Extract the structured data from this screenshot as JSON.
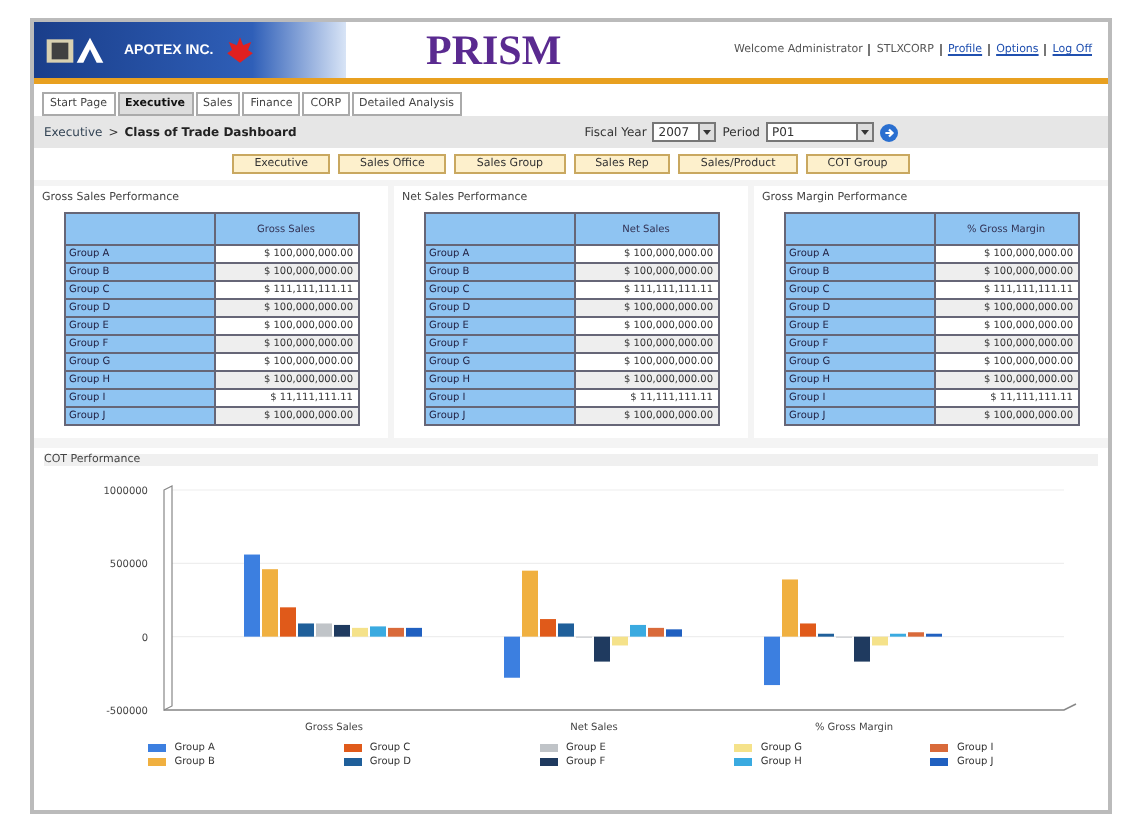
{
  "header": {
    "brand": "APOTEX INC.",
    "app_title": "PRISM",
    "welcome": "Welcome Administrator",
    "links": [
      "STLXCORP",
      "Profile",
      "Options",
      "Log Off"
    ]
  },
  "tabs": [
    {
      "label": "Start Page",
      "selected": false
    },
    {
      "label": "Executive",
      "selected": true
    },
    {
      "label": "Sales",
      "selected": false
    },
    {
      "label": "Finance",
      "selected": false
    },
    {
      "label": "CORP",
      "selected": false
    },
    {
      "label": "Detailed Analysis",
      "selected": false
    }
  ],
  "breadcrumb": {
    "parent": "Executive",
    "separator": ">",
    "current": "Class of Trade Dashboard"
  },
  "filters": {
    "fiscal_year_label": "Fiscal Year",
    "fiscal_year": "2007",
    "period_label": "Period",
    "period": "P01"
  },
  "views": [
    "Executive",
    "Sales Office",
    "Sales Group",
    "Sales Rep",
    "Sales/Product",
    "COT Group"
  ],
  "panels": [
    {
      "title": "Gross Sales Performance",
      "column": "Gross Sales",
      "rows": [
        {
          "label": "Group A",
          "value": "$ 100,000,000.00"
        },
        {
          "label": "Group B",
          "value": "$ 100,000,000.00"
        },
        {
          "label": "Group C",
          "value": "$ 111,111,111.11"
        },
        {
          "label": "Group D",
          "value": "$ 100,000,000.00"
        },
        {
          "label": "Group E",
          "value": "$ 100,000,000.00"
        },
        {
          "label": "Group F",
          "value": "$ 100,000,000.00"
        },
        {
          "label": "Group G",
          "value": "$ 100,000,000.00"
        },
        {
          "label": "Group H",
          "value": "$ 100,000,000.00"
        },
        {
          "label": "Group I",
          "value": "$ 11,111,111.11"
        },
        {
          "label": "Group J",
          "value": "$ 100,000,000.00"
        }
      ]
    },
    {
      "title": "Net Sales Performance",
      "column": "Net Sales",
      "rows": [
        {
          "label": "Group A",
          "value": "$ 100,000,000.00"
        },
        {
          "label": "Group B",
          "value": "$ 100,000,000.00"
        },
        {
          "label": "Group C",
          "value": "$ 111,111,111.11"
        },
        {
          "label": "Group D",
          "value": "$ 100,000,000.00"
        },
        {
          "label": "Group E",
          "value": "$ 100,000,000.00"
        },
        {
          "label": "Group F",
          "value": "$ 100,000,000.00"
        },
        {
          "label": "Group G",
          "value": "$ 100,000,000.00"
        },
        {
          "label": "Group H",
          "value": "$ 100,000,000.00"
        },
        {
          "label": "Group I",
          "value": "$ 11,111,111.11"
        },
        {
          "label": "Group J",
          "value": "$ 100,000,000.00"
        }
      ]
    },
    {
      "title": "Gross Margin Performance",
      "column": "% Gross Margin",
      "rows": [
        {
          "label": "Group A",
          "value": "$ 100,000,000.00"
        },
        {
          "label": "Group B",
          "value": "$ 100,000,000.00"
        },
        {
          "label": "Group C",
          "value": "$ 111,111,111.11"
        },
        {
          "label": "Group D",
          "value": "$ 100,000,000.00"
        },
        {
          "label": "Group E",
          "value": "$ 100,000,000.00"
        },
        {
          "label": "Group F",
          "value": "$ 100,000,000.00"
        },
        {
          "label": "Group G",
          "value": "$ 100,000,000.00"
        },
        {
          "label": "Group H",
          "value": "$ 100,000,000.00"
        },
        {
          "label": "Group I",
          "value": "$ 11,111,111.11"
        },
        {
          "label": "Group J",
          "value": "$ 100,000,000.00"
        }
      ]
    }
  ],
  "chart_panel": {
    "title": "COT Performance",
    "chart_data": {
      "type": "bar",
      "legend": "bottom",
      "categories": [
        "Gross Sales",
        "Net Sales",
        "% Gross Margin"
      ],
      "ylim": [
        -500000,
        1000000
      ],
      "yticks": [
        1000000,
        500000,
        0,
        -500000
      ],
      "series": [
        {
          "name": "Group A",
          "color": "#3c7fe0",
          "values": [
            560000,
            -280000,
            -330000
          ]
        },
        {
          "name": "Group B",
          "color": "#f0b040",
          "values": [
            460000,
            450000,
            390000
          ]
        },
        {
          "name": "Group C",
          "color": "#e05a1a",
          "values": [
            200000,
            120000,
            90000
          ]
        },
        {
          "name": "Group D",
          "color": "#1f5f9a",
          "values": [
            90000,
            90000,
            20000
          ]
        },
        {
          "name": "Group E",
          "color": "#c0c4c8",
          "values": [
            90000,
            0,
            0
          ]
        },
        {
          "name": "Group F",
          "color": "#1f3a5f",
          "values": [
            80000,
            -170000,
            -170000
          ]
        },
        {
          "name": "Group G",
          "color": "#f5e28a",
          "values": [
            60000,
            -60000,
            -60000
          ]
        },
        {
          "name": "Group H",
          "color": "#3aaae0",
          "values": [
            70000,
            80000,
            20000
          ]
        },
        {
          "name": "Group I",
          "color": "#d96a3a",
          "values": [
            60000,
            60000,
            30000
          ]
        },
        {
          "name": "Group J",
          "color": "#2060c0",
          "values": [
            60000,
            50000,
            20000
          ]
        }
      ]
    }
  }
}
